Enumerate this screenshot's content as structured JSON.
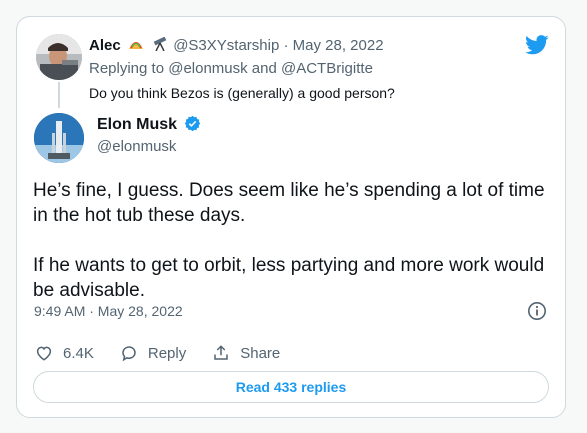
{
  "reply": {
    "name": "Alec",
    "handle_date": "@S3XYstarship · May 28, 2022",
    "replying_to": "Replying to @elonmusk and @ACTBrigitte",
    "text": "Do you think Bezos is (generally) a good person?"
  },
  "tweet": {
    "name": "Elon Musk",
    "handle": "@elonmusk",
    "body": "He’s fine, I guess. Does seem like he’s spending a lot of time in the hot tub these days.\n\nIf he wants to get to orbit, less partying and more work would be advisable.",
    "timestamp": "9:49 AM · May 28, 2022"
  },
  "actions": {
    "likes": "6.4K",
    "reply_label": "Reply",
    "share_label": "Share"
  },
  "read_replies_label": "Read 433 replies",
  "colors": {
    "accent": "#1d9bf0",
    "text": "#0f1419",
    "muted": "#536471",
    "border": "#cfd9de"
  },
  "icons": [
    "twitter-bird-icon",
    "verified-badge-icon",
    "heart-icon",
    "reply-icon",
    "share-icon",
    "info-icon",
    "taco-emoji-icon",
    "telescope-emoji-icon"
  ]
}
